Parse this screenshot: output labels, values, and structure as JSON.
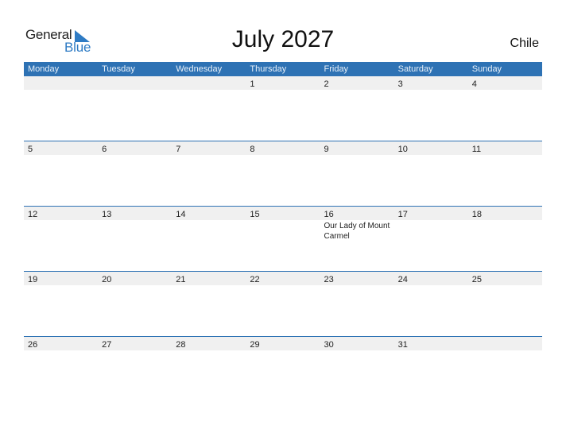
{
  "logo": {
    "word1": "General",
    "word2": "Blue",
    "accent": "#2e7bc4"
  },
  "title": "July 2027",
  "country": "Chile",
  "colors": {
    "header_bg": "#2e72b4",
    "strip_bg": "#f0f0f0"
  },
  "weekdays": [
    "Monday",
    "Tuesday",
    "Wednesday",
    "Thursday",
    "Friday",
    "Saturday",
    "Sunday"
  ],
  "weeks": [
    {
      "days": [
        "",
        "",
        "",
        "1",
        "2",
        "3",
        "4"
      ],
      "events": [
        "",
        "",
        "",
        "",
        "",
        "",
        ""
      ]
    },
    {
      "days": [
        "5",
        "6",
        "7",
        "8",
        "9",
        "10",
        "11"
      ],
      "events": [
        "",
        "",
        "",
        "",
        "",
        "",
        ""
      ]
    },
    {
      "days": [
        "12",
        "13",
        "14",
        "15",
        "16",
        "17",
        "18"
      ],
      "events": [
        "",
        "",
        "",
        "",
        "Our Lady of Mount Carmel",
        "",
        ""
      ]
    },
    {
      "days": [
        "19",
        "20",
        "21",
        "22",
        "23",
        "24",
        "25"
      ],
      "events": [
        "",
        "",
        "",
        "",
        "",
        "",
        ""
      ]
    },
    {
      "days": [
        "26",
        "27",
        "28",
        "29",
        "30",
        "31",
        ""
      ],
      "events": [
        "",
        "",
        "",
        "",
        "",
        "",
        ""
      ]
    }
  ]
}
